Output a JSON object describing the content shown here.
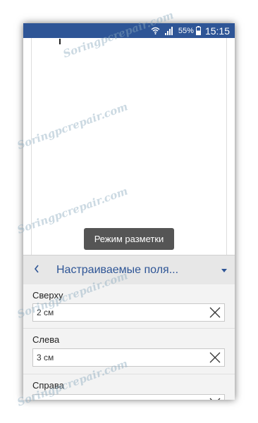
{
  "statusbar": {
    "battery_percent": "55%",
    "time": "15:15"
  },
  "toast": {
    "text": "Режим разметки"
  },
  "header": {
    "title": "Настраиваемые поля...",
    "back_icon": "chevron-left-icon",
    "dropdown_icon": "caret-down-icon"
  },
  "fields": [
    {
      "label": "Сверху",
      "value": "2 см"
    },
    {
      "label": "Слева",
      "value": "3 см"
    },
    {
      "label": "Справа",
      "value": ""
    }
  ],
  "watermark": "Soringpcrepair.com",
  "colors": {
    "accent": "#2e5596",
    "header_bg": "#e7e7e7",
    "panel_bg": "#f3f3f3",
    "toast_bg": "#555555"
  }
}
